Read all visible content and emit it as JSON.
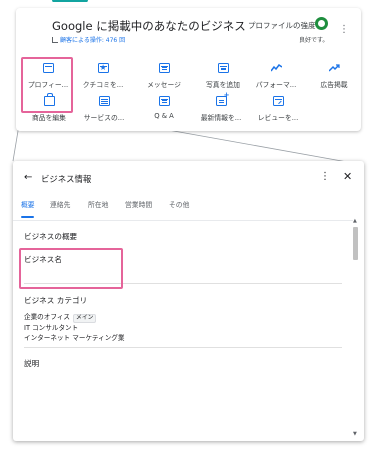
{
  "business_panel": {
    "title": "Google に掲載中のあなたのビジネス",
    "subtitle": "顧客による操作: 476 回",
    "profile_strength_label": "プロファイルの強度",
    "profile_strength_status": "良好です。",
    "strength_color": "#1e8e3e",
    "accent_color": "#1a73e8",
    "highlight_color": "#e5649a",
    "actions_row1": [
      {
        "label": "プロフィー...",
        "icon": "profile-card-icon"
      },
      {
        "label": "クチコミを...",
        "icon": "star-review-icon"
      },
      {
        "label": "メッセージ",
        "icon": "message-icon"
      },
      {
        "label": "写真を追加",
        "icon": "photo-icon"
      },
      {
        "label": "パフォーマ...",
        "icon": "performance-icon"
      },
      {
        "label": "広告掲載",
        "icon": "ads-trend-icon"
      }
    ],
    "actions_row2": [
      {
        "label": "商品を編集",
        "icon": "shopping-bag-icon"
      },
      {
        "label": "サービスの...",
        "icon": "services-list-icon"
      },
      {
        "label": "Q & A",
        "icon": "qa-icon"
      },
      {
        "label": "最新情報を...",
        "icon": "add-post-icon"
      },
      {
        "label": "レビューを...",
        "icon": "review-link-icon"
      }
    ]
  },
  "dialog": {
    "title": "ビジネス情報",
    "tabs": [
      "概要",
      "連絡先",
      "所在地",
      "営業時間",
      "その他"
    ],
    "active_tab": "概要",
    "section_title": "ビジネスの概要",
    "business_name_label": "ビジネス名",
    "category_label": "ビジネス カテゴリ",
    "categories": [
      {
        "name": "企業のオフィス",
        "badge": "メイン"
      },
      {
        "name": "IT コンサルタント"
      },
      {
        "name": "インターネット マーケティング業"
      }
    ],
    "description_label": "説明"
  }
}
